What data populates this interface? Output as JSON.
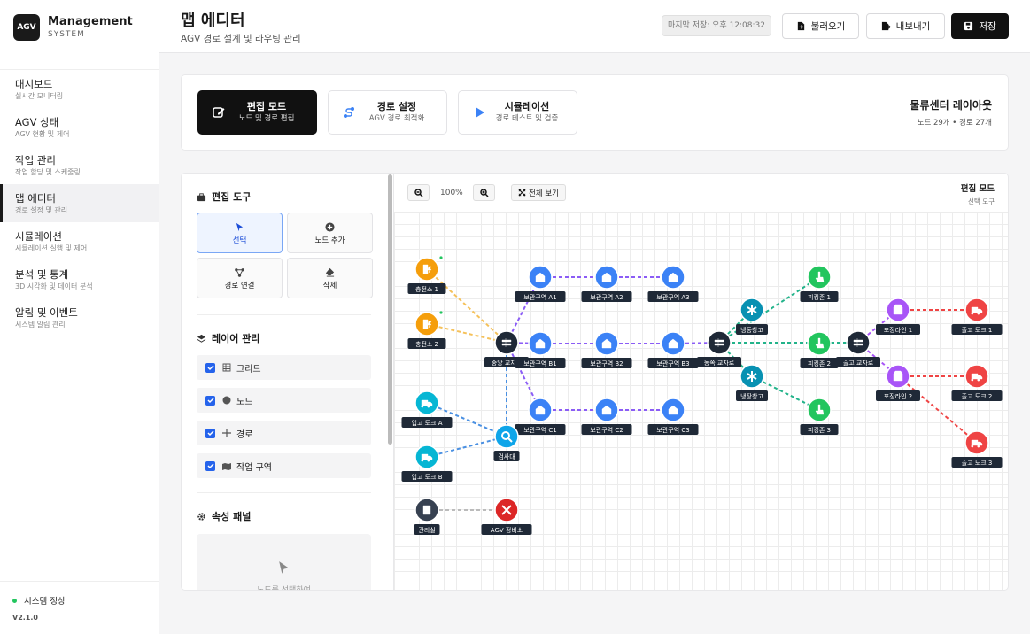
{
  "sidebar": {
    "logo": "AGV",
    "title": "Management",
    "subtitle": "SYSTEM",
    "items": [
      {
        "label": "대시보드",
        "sub": "실시간 모니터링"
      },
      {
        "label": "AGV 상태",
        "sub": "AGV 현황 및 제어"
      },
      {
        "label": "작업 관리",
        "sub": "작업 할당 및 스케줄링"
      },
      {
        "label": "맵 에디터",
        "sub": "경로 설정 및 관리"
      },
      {
        "label": "시뮬레이션",
        "sub": "시뮬레이션 실행 및 제어"
      },
      {
        "label": "분석 및 통계",
        "sub": "3D 시각화 및 데이터 분석"
      },
      {
        "label": "알림 및 이벤트",
        "sub": "시스템 알림 관리"
      }
    ],
    "status": "시스템 정상",
    "version": "V2.1.0"
  },
  "header": {
    "title": "맵 에디터",
    "subtitle": "AGV 경로 설계 및 라우팅 관리",
    "saved": "마지막 저장: 오후 12:08:32",
    "load": "불러오기",
    "export": "내보내기",
    "save": "저장"
  },
  "modes": [
    {
      "title": "편집 모드",
      "sub": "노드 및 경로 편집"
    },
    {
      "title": "경로 설정",
      "sub": "AGV 경로 최적화"
    },
    {
      "title": "시뮬레이션",
      "sub": "경로 테스트 및 검증"
    }
  ],
  "layout": {
    "name": "물류센터 레이아웃",
    "stats": "노드 29개 • 경로 27개"
  },
  "tools": {
    "title": "편집 도구",
    "items": [
      "선택",
      "노드 추가",
      "경로 연결",
      "삭제"
    ],
    "layers_title": "레이어 관리",
    "layers": [
      "그리드",
      "노드",
      "경로",
      "작업 구역"
    ],
    "props_title": "속성 패널",
    "props_hint": "노드를 선택하여"
  },
  "canvas": {
    "zoom": "100%",
    "fit": "전체 보기",
    "mode": "편집 모드",
    "tool": "선택 도구"
  },
  "colors": {
    "orange": "#f59e0b",
    "blue": "#3b82f6",
    "teal": "#06b6d4",
    "dark": "#1f2937",
    "green": "#22c55e",
    "purple": "#a855f7",
    "red": "#ef4444",
    "accent": "#2563eb"
  },
  "map": {
    "nodes": [
      {
        "id": "c1",
        "label": "충전소 1",
        "type": "charge",
        "color": "#f59e0b"
      },
      {
        "id": "c2",
        "label": "충전소 2",
        "type": "charge",
        "color": "#f59e0b"
      },
      {
        "id": "hub",
        "label": "중앙 교차로",
        "type": "cross",
        "color": "#1f2937"
      },
      {
        "id": "a1",
        "label": "보관구역 A1",
        "type": "store",
        "color": "#3b82f6"
      },
      {
        "id": "a2",
        "label": "보관구역 A2",
        "type": "store",
        "color": "#3b82f6"
      },
      {
        "id": "a3",
        "label": "보관구역 A3",
        "type": "store",
        "color": "#3b82f6"
      },
      {
        "id": "b1",
        "label": "보관구역 B1",
        "type": "store",
        "color": "#3b82f6"
      },
      {
        "id": "b2",
        "label": "보관구역 B2",
        "type": "store",
        "color": "#3b82f6"
      },
      {
        "id": "b3",
        "label": "보관구역 B3",
        "type": "store",
        "color": "#3b82f6"
      },
      {
        "id": "cc1",
        "label": "보관구역 C1",
        "type": "store",
        "color": "#3b82f6"
      },
      {
        "id": "cc2",
        "label": "보관구역 C2",
        "type": "store",
        "color": "#3b82f6"
      },
      {
        "id": "cc3",
        "label": "보관구역 C3",
        "type": "store",
        "color": "#3b82f6"
      },
      {
        "id": "ia",
        "label": "입고 도크 A",
        "type": "truck",
        "color": "#06b6d4"
      },
      {
        "id": "ib",
        "label": "입고 도크 B",
        "type": "truck",
        "color": "#06b6d4"
      },
      {
        "id": "insp",
        "label": "검사대",
        "type": "search",
        "color": "#0ea5e9"
      },
      {
        "id": "mgmt",
        "label": "관리실",
        "type": "office",
        "color": "#374151"
      },
      {
        "id": "svc",
        "label": "AGV 정비소",
        "type": "tool",
        "color": "#dc2626"
      },
      {
        "id": "east",
        "label": "동쪽 교차로",
        "type": "cross",
        "color": "#1f2937"
      },
      {
        "id": "f1",
        "label": "냉동창고",
        "type": "cold",
        "color": "#0891b2"
      },
      {
        "id": "f2",
        "label": "냉장창고",
        "type": "cold",
        "color": "#0891b2"
      },
      {
        "id": "p1",
        "label": "피킹존 1",
        "type": "pick",
        "color": "#22c55e"
      },
      {
        "id": "p2",
        "label": "피킹존 2",
        "type": "pick",
        "color": "#22c55e"
      },
      {
        "id": "p3",
        "label": "피킹존 3",
        "type": "pick",
        "color": "#22c55e"
      },
      {
        "id": "out",
        "label": "출고 교차로",
        "type": "cross",
        "color": "#1f2937"
      },
      {
        "id": "pk1",
        "label": "포장라인 1",
        "type": "box",
        "color": "#a855f7"
      },
      {
        "id": "pk2",
        "label": "포장라인 2",
        "type": "box",
        "color": "#a855f7"
      },
      {
        "id": "o1",
        "label": "출고 도크 1",
        "type": "truck",
        "color": "#ef4444"
      },
      {
        "id": "o2",
        "label": "출고 도크 2",
        "type": "truck",
        "color": "#ef4444"
      },
      {
        "id": "o3",
        "label": "출고 도크 3",
        "type": "truck",
        "color": "#ef4444"
      }
    ],
    "edges": [
      [
        "c1",
        "hub",
        "#f5c15a"
      ],
      [
        "c2",
        "hub",
        "#f5c15a"
      ],
      [
        "hub",
        "a1",
        "#8b5cf6"
      ],
      [
        "hub",
        "b1",
        "#8b5cf6"
      ],
      [
        "hub",
        "cc1",
        "#8b5cf6"
      ],
      [
        "a1",
        "a2",
        "#8b5cf6"
      ],
      [
        "a2",
        "a3",
        "#8b5cf6"
      ],
      [
        "b1",
        "b2",
        "#8b5cf6"
      ],
      [
        "b2",
        "b3",
        "#8b5cf6"
      ],
      [
        "b3",
        "east",
        "#8b5cf6"
      ],
      [
        "cc1",
        "cc2",
        "#8b5cf6"
      ],
      [
        "cc2",
        "cc3",
        "#8b5cf6"
      ],
      [
        "hub",
        "insp",
        "#4a90e2"
      ],
      [
        "ia",
        "insp",
        "#4a90e2"
      ],
      [
        "ib",
        "insp",
        "#4a90e2"
      ],
      [
        "mgmt",
        "svc",
        "#bbbbbb"
      ],
      [
        "east",
        "p1",
        "#22b38a"
      ],
      [
        "east",
        "p2",
        "#22b38a"
      ],
      [
        "f2",
        "p3",
        "#22b38a"
      ],
      [
        "east",
        "f1",
        "#22b38a"
      ],
      [
        "east",
        "f2",
        "#22b38a"
      ],
      [
        "east",
        "out",
        "#22b38a"
      ],
      [
        "out",
        "pk1",
        "#a855f7"
      ],
      [
        "out",
        "pk2",
        "#a855f7"
      ],
      [
        "pk1",
        "o1",
        "#ef4444"
      ],
      [
        "pk2",
        "o2",
        "#ef4444"
      ],
      [
        "pk2",
        "o3",
        "#ef4444"
      ]
    ]
  }
}
